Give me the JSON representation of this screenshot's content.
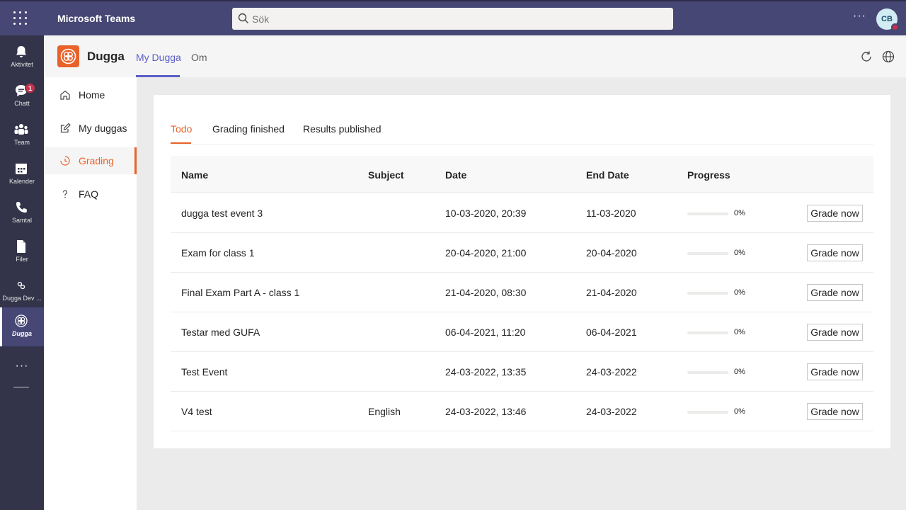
{
  "topbar": {
    "app_title": "Microsoft Teams",
    "search_placeholder": "Sök",
    "more_label": "···",
    "avatar_initials": "CB"
  },
  "rail": {
    "items": [
      {
        "label": "Aktivitet",
        "icon": "bell-icon"
      },
      {
        "label": "Chatt",
        "icon": "chat-icon",
        "badge": "1"
      },
      {
        "label": "Team",
        "icon": "team-icon"
      },
      {
        "label": "Kalender",
        "icon": "calendar-icon"
      },
      {
        "label": "Samtal",
        "icon": "phone-icon"
      },
      {
        "label": "Filer",
        "icon": "file-icon"
      },
      {
        "label": "Dugga Dev ...",
        "icon": "dugga-dev-icon"
      },
      {
        "label": "Dugga",
        "icon": "dugga-icon",
        "active": true
      }
    ],
    "more_label": "···"
  },
  "app_header": {
    "app_name": "Dugga",
    "tabs": [
      {
        "label": "My Dugga",
        "active": true
      },
      {
        "label": "Om"
      }
    ]
  },
  "sidenav": {
    "items": [
      {
        "label": "Home",
        "icon": "home-icon"
      },
      {
        "label": "My duggas",
        "icon": "edit-icon"
      },
      {
        "label": "Grading",
        "icon": "clock-icon",
        "active": true
      },
      {
        "label": "FAQ",
        "icon": "question-icon"
      }
    ]
  },
  "content": {
    "tabs": [
      {
        "label": "Todo",
        "active": true
      },
      {
        "label": "Grading finished"
      },
      {
        "label": "Results published"
      }
    ],
    "columns": [
      "Name",
      "Subject",
      "Date",
      "End Date",
      "Progress"
    ],
    "grade_button_label": "Grade now",
    "rows": [
      {
        "name": "dugga test event 3",
        "subject": "",
        "date": "10-03-2020, 20:39",
        "end_date": "11-03-2020",
        "progress": 0,
        "progress_label": "0%"
      },
      {
        "name": "Exam for class 1",
        "subject": "",
        "date": "20-04-2020, 21:00",
        "end_date": "20-04-2020",
        "progress": 0,
        "progress_label": "0%"
      },
      {
        "name": "Final Exam Part A - class 1",
        "subject": "",
        "date": "21-04-2020, 08:30",
        "end_date": "21-04-2020",
        "progress": 0,
        "progress_label": "0%"
      },
      {
        "name": "Testar med GUFA",
        "subject": "",
        "date": "06-04-2021, 11:20",
        "end_date": "06-04-2021",
        "progress": 0,
        "progress_label": "0%"
      },
      {
        "name": "Test Event",
        "subject": "",
        "date": "24-03-2022, 13:35",
        "end_date": "24-03-2022",
        "progress": 0,
        "progress_label": "0%"
      },
      {
        "name": "V4 test",
        "subject": "English",
        "date": "24-03-2022, 13:46",
        "end_date": "24-03-2022",
        "progress": 0,
        "progress_label": "0%"
      }
    ]
  },
  "colors": {
    "teams_purple": "#464775",
    "rail_dark": "#33344a",
    "accent_orange": "#e8622a",
    "tab_blue": "#5b5fc7"
  }
}
